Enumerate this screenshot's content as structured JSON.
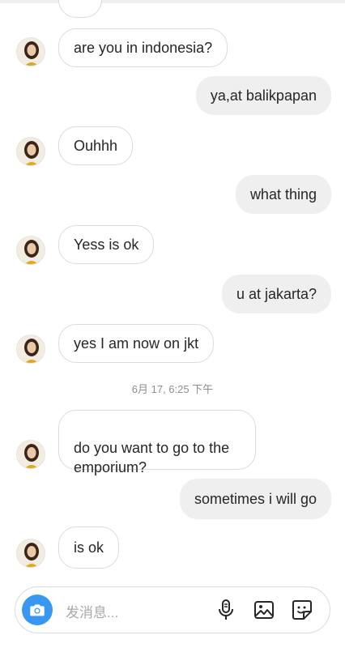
{
  "messages": [
    {
      "from": "them",
      "text": "are you in indonesia?"
    },
    {
      "from": "me",
      "text": "ya,at balikpapan"
    },
    {
      "from": "them",
      "text": "Ouhhh"
    },
    {
      "from": "me",
      "text": "what thing"
    },
    {
      "from": "them",
      "text": "Yess is ok"
    },
    {
      "from": "me",
      "text": "u at jakarta?"
    },
    {
      "from": "them",
      "text": "yes I am now on jkt"
    },
    {
      "from": "them",
      "text": "do you want to go to the\nemporium?"
    },
    {
      "from": "me",
      "text": "sometimes i will go"
    },
    {
      "from": "them",
      "text": "is ok"
    }
  ],
  "timestamp": "6月 17, 6:25 下午",
  "composer": {
    "placeholder": "发消息...",
    "icons": [
      "camera-icon",
      "microphone-icon",
      "image-icon",
      "sticker-icon"
    ]
  },
  "colors": {
    "accent": "#3897f0",
    "incoming_border": "#dbdbdb",
    "outgoing_bg": "#efefef",
    "text": "#262626",
    "muted": "#8e8e8e"
  }
}
